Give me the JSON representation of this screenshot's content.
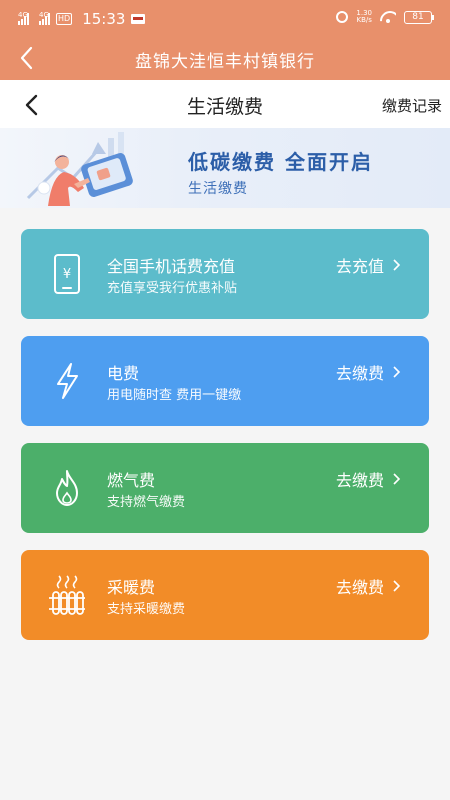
{
  "status_bar": {
    "signal1": "4G",
    "signal2": "4G",
    "hd": "HD",
    "time": "15:33",
    "net_speed_value": "1.30",
    "net_speed_unit": "KB/s",
    "battery": "81"
  },
  "app_header": {
    "title": "盘锦大洼恒丰村镇银行"
  },
  "page_nav": {
    "title": "生活缴费",
    "record_link": "缴费记录"
  },
  "banner": {
    "headline": "低碳缴费  全面开启",
    "subtitle": "生活缴费"
  },
  "services": [
    {
      "title": "全国手机话费充值",
      "desc": "充值享受我行优惠补贴",
      "action": "去充值",
      "color": "#5cbccb",
      "icon": "phone-yuan-icon"
    },
    {
      "title": "电费",
      "desc": "用电随时查 费用一键缴",
      "action": "去缴费",
      "color": "#4e9ef0",
      "icon": "lightning-icon"
    },
    {
      "title": "燃气费",
      "desc": "支持燃气缴费",
      "action": "去缴费",
      "color": "#4caf6a",
      "icon": "flame-icon"
    },
    {
      "title": "采暖费",
      "desc": "支持采暖缴费",
      "action": "去缴费",
      "color": "#f28c28",
      "icon": "radiator-icon"
    }
  ]
}
